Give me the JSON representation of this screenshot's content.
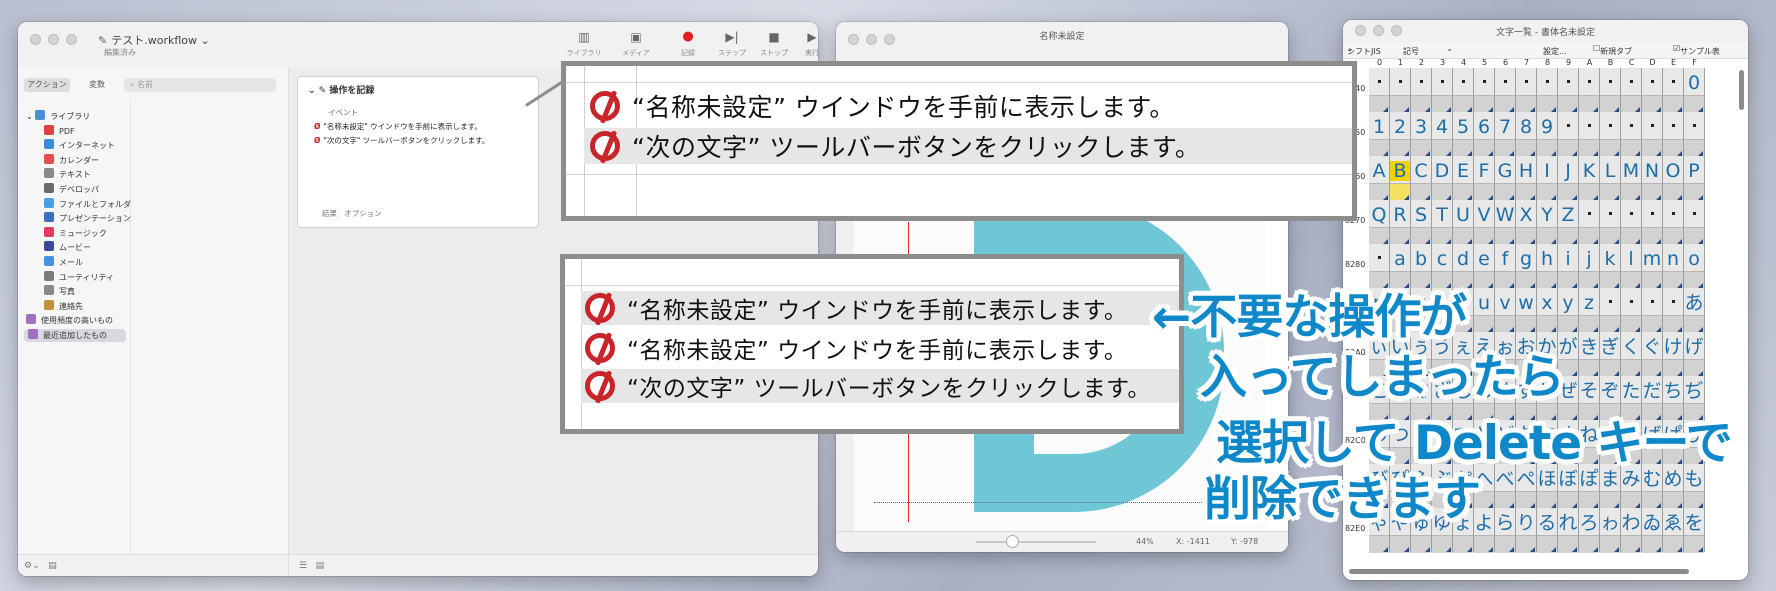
{
  "automator": {
    "window_title": "テスト.workflow",
    "subtitle": "編集済み",
    "toolbar": [
      "ライブラリ",
      "メディア",
      "記録",
      "ステップ",
      "ストップ",
      "実行"
    ],
    "search_tabs": [
      "アクション",
      "変数"
    ],
    "search_placeholder": "名前",
    "library_items": [
      {
        "label": "ライブラリ",
        "color": "#4a90d9"
      },
      {
        "label": "PDF",
        "color": "#e04040"
      },
      {
        "label": "インターネット",
        "color": "#3a8fd8"
      },
      {
        "label": "カレンダー",
        "color": "#e05050"
      },
      {
        "label": "テキスト",
        "color": "#8a8a8a"
      },
      {
        "label": "デベロッパ",
        "color": "#6a6a6a"
      },
      {
        "label": "ファイルとフォルダ",
        "color": "#4aa0e0"
      },
      {
        "label": "プレゼンテーション",
        "color": "#3a70c0"
      },
      {
        "label": "ミュージック",
        "color": "#e04060"
      },
      {
        "label": "ムービー",
        "color": "#3a4a9a"
      },
      {
        "label": "メール",
        "color": "#4a90e0"
      },
      {
        "label": "ユーティリティ",
        "color": "#7a7a7a"
      },
      {
        "label": "写真",
        "color": "#8a8a8a"
      },
      {
        "label": "連絡先",
        "color": "#c0903a"
      },
      {
        "label": "使用頻度の高いもの",
        "color": "#a070c0"
      },
      {
        "label": "最近追加したもの",
        "color": "#a070c0"
      }
    ],
    "action": {
      "title": "操作を記録",
      "column": "イベント",
      "rows": [
        "\"名称未設定\" ウインドウを手前に表示します。",
        "\"次の文字\" ツールバーボタンをクリックします。"
      ],
      "footer": [
        "結果",
        "オプション"
      ]
    }
  },
  "editor": {
    "window_title": "名称未設定",
    "status": {
      "zoom": "44%",
      "x": "X: -1411",
      "y": "Y: -978"
    }
  },
  "charlist": {
    "window_title": "文字一覧 - 書体名未設定",
    "toolbar": {
      "mode": "シフトJIS",
      "category": "記号",
      "settings": "設定...",
      "newtab": "新規タブ",
      "sample": "サンプル表"
    },
    "columns": [
      "0",
      "1",
      "2",
      "3",
      "4",
      "5",
      "6",
      "7",
      "8",
      "9",
      "A",
      "B",
      "C",
      "D",
      "E",
      "F"
    ],
    "row_labels": [
      "8140",
      "8150",
      "8260",
      "8270",
      "8280",
      "8290",
      "82A0",
      "82B0",
      "82C0",
      "82D0",
      "82E0"
    ],
    "rows": [
      [
        "",
        "",
        "",
        "",
        "",
        "",
        "",
        "",
        "",
        "",
        "",
        "",
        "",
        "",
        "",
        "0"
      ],
      [
        "1",
        "2",
        "3",
        "4",
        "5",
        "6",
        "7",
        "8",
        "9",
        "",
        "",
        "",
        "",
        "",
        "",
        ""
      ],
      [
        "A",
        "B",
        "C",
        "D",
        "E",
        "F",
        "G",
        "H",
        "I",
        "J",
        "K",
        "L",
        "M",
        "N",
        "O",
        "P"
      ],
      [
        "Q",
        "R",
        "S",
        "T",
        "U",
        "V",
        "W",
        "X",
        "Y",
        "Z",
        "",
        "",
        "",
        "",
        "",
        ""
      ],
      [
        "",
        "a",
        "b",
        "c",
        "d",
        "e",
        "f",
        "g",
        "h",
        "i",
        "j",
        "k",
        "l",
        "m",
        "n",
        "o"
      ],
      [
        "p",
        "q",
        "r",
        "s",
        "t",
        "u",
        "v",
        "w",
        "x",
        "y",
        "z",
        "",
        "",
        "",
        "",
        "あ"
      ],
      [
        "ぃ",
        "い",
        "ぅ",
        "う",
        "ぇ",
        "え",
        "ぉ",
        "お",
        "か",
        "が",
        "き",
        "ぎ",
        "く",
        "ぐ",
        "け",
        "げ"
      ],
      [
        "こ",
        "ご",
        "さ",
        "ざ",
        "し",
        "じ",
        "す",
        "ず",
        "せ",
        "ぜ",
        "そ",
        "ぞ",
        "た",
        "だ",
        "ち",
        "ぢ"
      ],
      [
        "っ",
        "つ",
        "づ",
        "て",
        "で",
        "と",
        "ど",
        "な",
        "に",
        "ぬ",
        "ね",
        "の",
        "は",
        "ば",
        "ぱ",
        "ひ"
      ],
      [
        "び",
        "ぴ",
        "ふ",
        "ぶ",
        "ぷ",
        "へ",
        "べ",
        "ぺ",
        "ほ",
        "ぼ",
        "ぽ",
        "ま",
        "み",
        "む",
        "め",
        "も"
      ],
      [
        "ゃ",
        "や",
        "ゅ",
        "ゆ",
        "ょ",
        "よ",
        "ら",
        "り",
        "る",
        "れ",
        "ろ",
        "ゎ",
        "わ",
        "ゐ",
        "ゑ",
        "を"
      ]
    ]
  },
  "callout_top": {
    "lines": [
      "“名称未設定” ウインドウを手前に表示します。",
      "“次の文字” ツールバーボタンをクリックします。"
    ]
  },
  "callout_bottom": {
    "lines": [
      "“名称未設定” ウインドウを手前に表示します。",
      "“名称未設定” ウインドウを手前に表示します。",
      "“次の文字” ツールバーボタンをクリックします。"
    ]
  },
  "annotation": {
    "line1": "←不要な操作が",
    "line2": "入ってしまったら",
    "line3": "選択して Delete キーで",
    "line4": "削除できます",
    "color": "#0f88c9"
  }
}
